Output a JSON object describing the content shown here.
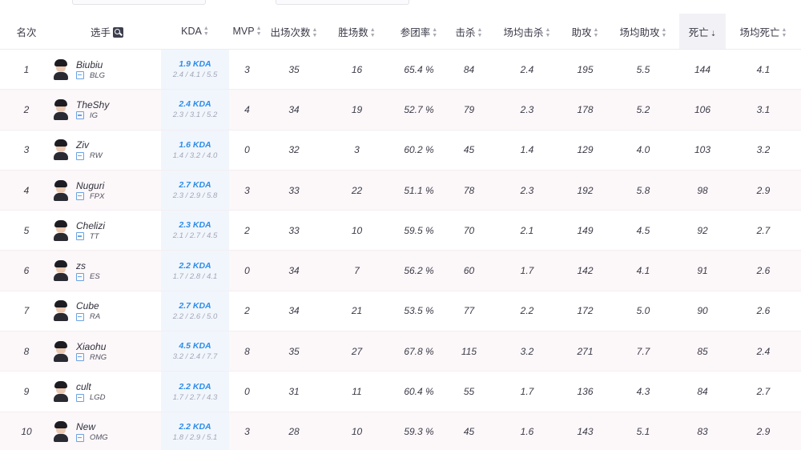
{
  "columns": {
    "rank": "名次",
    "player": "选手",
    "kda": "KDA",
    "mvp": "MVP",
    "games": "出场次数",
    "wins": "胜场数",
    "kp": "参团率",
    "kills": "击杀",
    "avg_kills": "场均击杀",
    "assists": "助攻",
    "avg_assists": "场均助攻",
    "deaths": "死亡",
    "avg_deaths": "场均死亡"
  },
  "sorted_by": "deaths",
  "rows": [
    {
      "rank": "1",
      "name": "Biubiu",
      "team": "BLG",
      "kda": "1.9 KDA",
      "kda_detail": "2.4 / 4.1 / 5.5",
      "mvp": "3",
      "games": "35",
      "wins": "16",
      "kp": "65.4 %",
      "kills": "84",
      "avg_kills": "2.4",
      "assists": "195",
      "avg_assists": "5.5",
      "deaths": "144",
      "avg_deaths": "4.1"
    },
    {
      "rank": "2",
      "name": "TheShy",
      "team": "IG",
      "kda": "2.4 KDA",
      "kda_detail": "2.3 / 3.1 / 5.2",
      "mvp": "4",
      "games": "34",
      "wins": "19",
      "kp": "52.7 %",
      "kills": "79",
      "avg_kills": "2.3",
      "assists": "178",
      "avg_assists": "5.2",
      "deaths": "106",
      "avg_deaths": "3.1"
    },
    {
      "rank": "3",
      "name": "Ziv",
      "team": "RW",
      "kda": "1.6 KDA",
      "kda_detail": "1.4 / 3.2 / 4.0",
      "mvp": "0",
      "games": "32",
      "wins": "3",
      "kp": "60.2 %",
      "kills": "45",
      "avg_kills": "1.4",
      "assists": "129",
      "avg_assists": "4.0",
      "deaths": "103",
      "avg_deaths": "3.2"
    },
    {
      "rank": "4",
      "name": "Nuguri",
      "team": "FPX",
      "kda": "2.7 KDA",
      "kda_detail": "2.3 / 2.9 / 5.8",
      "mvp": "3",
      "games": "33",
      "wins": "22",
      "kp": "51.1 %",
      "kills": "78",
      "avg_kills": "2.3",
      "assists": "192",
      "avg_assists": "5.8",
      "deaths": "98",
      "avg_deaths": "2.9"
    },
    {
      "rank": "5",
      "name": "Chelizi",
      "team": "TT",
      "kda": "2.3 KDA",
      "kda_detail": "2.1 / 2.7 / 4.5",
      "mvp": "2",
      "games": "33",
      "wins": "10",
      "kp": "59.5 %",
      "kills": "70",
      "avg_kills": "2.1",
      "assists": "149",
      "avg_assists": "4.5",
      "deaths": "92",
      "avg_deaths": "2.7"
    },
    {
      "rank": "6",
      "name": "zs",
      "team": "ES",
      "kda": "2.2 KDA",
      "kda_detail": "1.7 / 2.8 / 4.1",
      "mvp": "0",
      "games": "34",
      "wins": "7",
      "kp": "56.2 %",
      "kills": "60",
      "avg_kills": "1.7",
      "assists": "142",
      "avg_assists": "4.1",
      "deaths": "91",
      "avg_deaths": "2.6"
    },
    {
      "rank": "7",
      "name": "Cube",
      "team": "RA",
      "kda": "2.7 KDA",
      "kda_detail": "2.2 / 2.6 / 5.0",
      "mvp": "2",
      "games": "34",
      "wins": "21",
      "kp": "53.5 %",
      "kills": "77",
      "avg_kills": "2.2",
      "assists": "172",
      "avg_assists": "5.0",
      "deaths": "90",
      "avg_deaths": "2.6"
    },
    {
      "rank": "8",
      "name": "Xiaohu",
      "team": "RNG",
      "kda": "4.5 KDA",
      "kda_detail": "3.2 / 2.4 / 7.7",
      "mvp": "8",
      "games": "35",
      "wins": "27",
      "kp": "67.8 %",
      "kills": "115",
      "avg_kills": "3.2",
      "assists": "271",
      "avg_assists": "7.7",
      "deaths": "85",
      "avg_deaths": "2.4"
    },
    {
      "rank": "9",
      "name": "cult",
      "team": "LGD",
      "kda": "2.2 KDA",
      "kda_detail": "1.7 / 2.7 / 4.3",
      "mvp": "0",
      "games": "31",
      "wins": "11",
      "kp": "60.4 %",
      "kills": "55",
      "avg_kills": "1.7",
      "assists": "136",
      "avg_assists": "4.3",
      "deaths": "84",
      "avg_deaths": "2.7"
    },
    {
      "rank": "10",
      "name": "New",
      "team": "OMG",
      "kda": "2.2 KDA",
      "kda_detail": "1.8 / 2.9 / 5.1",
      "mvp": "3",
      "games": "28",
      "wins": "10",
      "kp": "59.3 %",
      "kills": "45",
      "avg_kills": "1.6",
      "assists": "143",
      "avg_assists": "5.1",
      "deaths": "83",
      "avg_deaths": "2.9"
    }
  ],
  "colors": {
    "kda_accent": "#2d8de8",
    "row_tint": "#fdf3f6",
    "kda_column_bg": "#f1f6fd",
    "team_icon": "#6aa3e4"
  },
  "icons": {
    "player_search": "search-icon",
    "team": "team-icon",
    "sort": "sort-arrows-icon"
  }
}
